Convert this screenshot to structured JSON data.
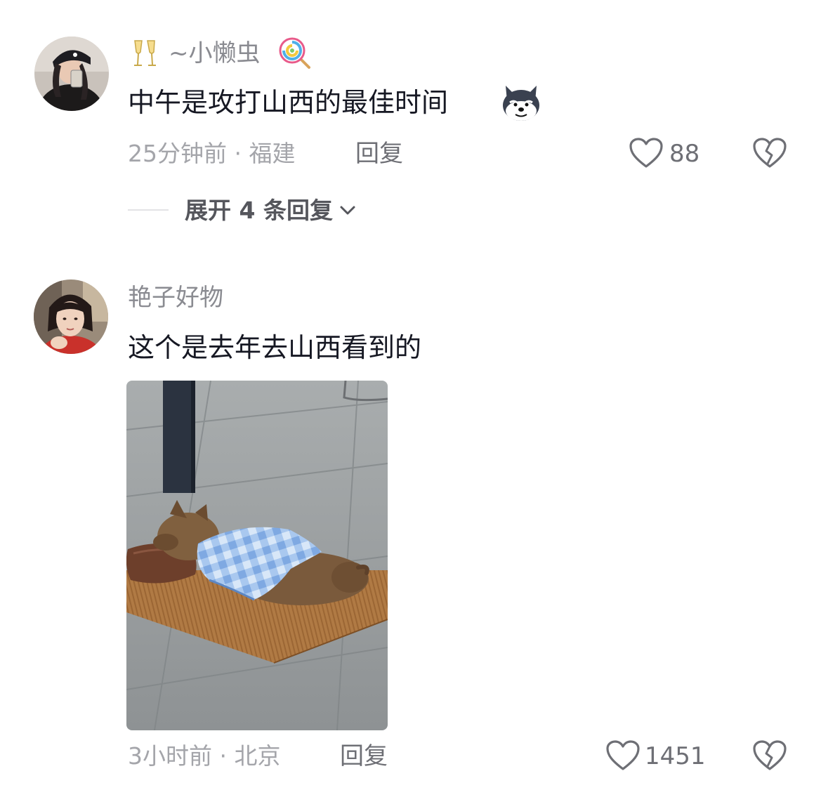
{
  "comments": [
    {
      "username": "~小懒虫",
      "text": "中午是攻打山西的最佳时间",
      "time": "25分钟前",
      "location": "福建",
      "reply_label": "回复",
      "likes": "88",
      "expand_label": "展开 4 条回复",
      "prefix_emoji": "champagne-glasses",
      "suffix_emoji": "lollipop",
      "content_emoji": "husky-dog-face"
    },
    {
      "username": "艳子好物",
      "text": "这个是去年去山西看到的",
      "time": "3小时前",
      "location": "北京",
      "reply_label": "回复",
      "likes": "1451",
      "attachment": "photo-dog-sleeping-on-mat-under-blanket"
    }
  ],
  "meta_separator": "·"
}
